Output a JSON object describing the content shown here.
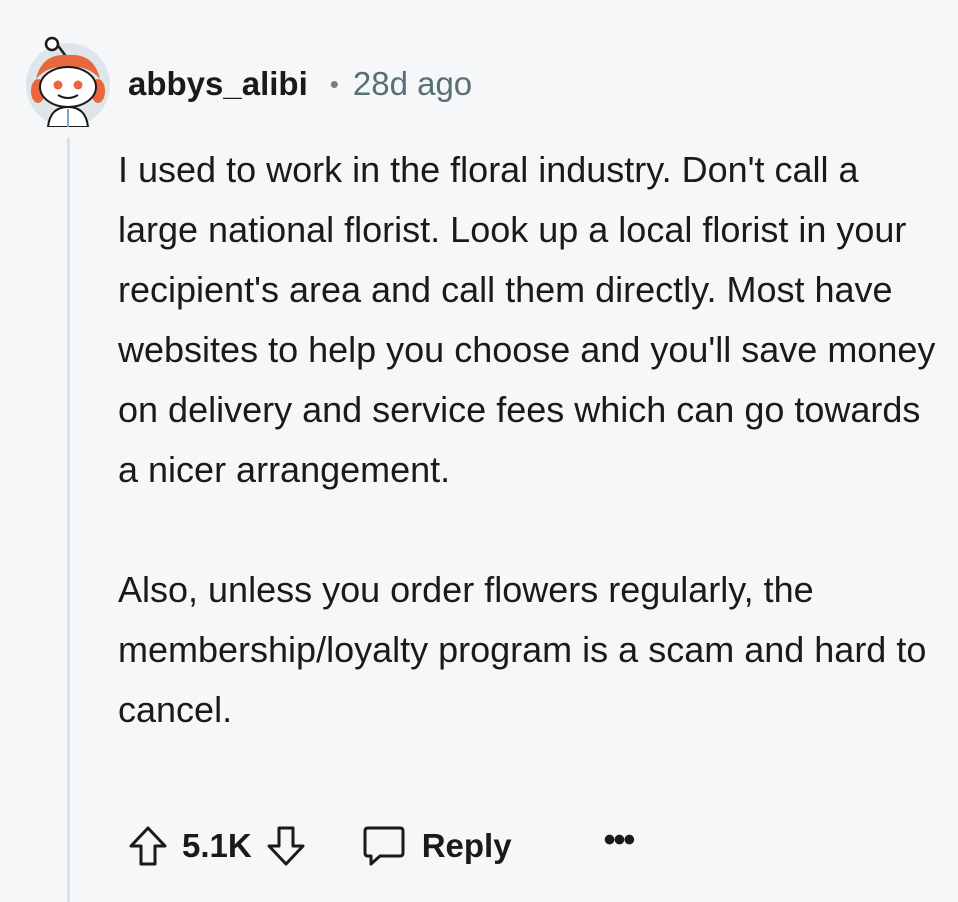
{
  "comment": {
    "author": "abbys_alibi",
    "separator": "•",
    "timestamp": "28d ago",
    "paragraphs": [
      "I used to work in the floral industry. Don't call a large national florist. Look up a local florist in your recipient's area and call them directly. Most have websites to help you choose and you'll save money on delivery and service fees which can go towards a nicer arrangement.",
      "Also, unless you order flowers regularly, the membership/loyalty program is a scam and hard to cancel."
    ]
  },
  "actions": {
    "upvote_icon": "arrow-up-icon",
    "score": "5.1K",
    "downvote_icon": "arrow-down-icon",
    "reply_icon": "speech-bubble-icon",
    "reply_label": "Reply",
    "more_label": "•••"
  },
  "colors": {
    "background": "#f6f7f8",
    "text": "#1a1a1b",
    "meta": "#576f76",
    "thread_line": "#dbe1e6",
    "avatar_bg": "#dfe6ea",
    "avatar_accent": "#e8673c"
  }
}
